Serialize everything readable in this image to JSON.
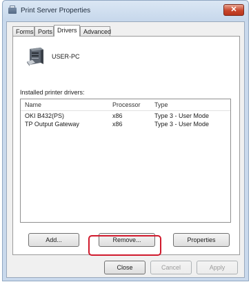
{
  "window": {
    "title": "Print Server Properties",
    "close_symbol": "✕"
  },
  "tabs": [
    {
      "label": "Forms"
    },
    {
      "label": "Ports"
    },
    {
      "label": "Drivers",
      "active": true
    },
    {
      "label": "Advanced"
    }
  ],
  "server": {
    "name": "USER-PC",
    "icon": "computer-icon"
  },
  "drivers": {
    "label": "Installed printer drivers:",
    "columns": [
      "Name",
      "Processor",
      "Type"
    ],
    "rows": [
      {
        "name": "OKI B432(PS)",
        "processor": "x86",
        "type": "Type 3 - User Mode"
      },
      {
        "name": "TP Output Gateway",
        "processor": "x86",
        "type": "Type 3 - User Mode"
      }
    ]
  },
  "buttons": {
    "add": "Add...",
    "remove": "Remove...",
    "properties": "Properties",
    "close": "Close",
    "cancel": "Cancel",
    "apply": "Apply"
  },
  "colors": {
    "highlight": "#d0192c",
    "close_button": "#c8452b"
  }
}
